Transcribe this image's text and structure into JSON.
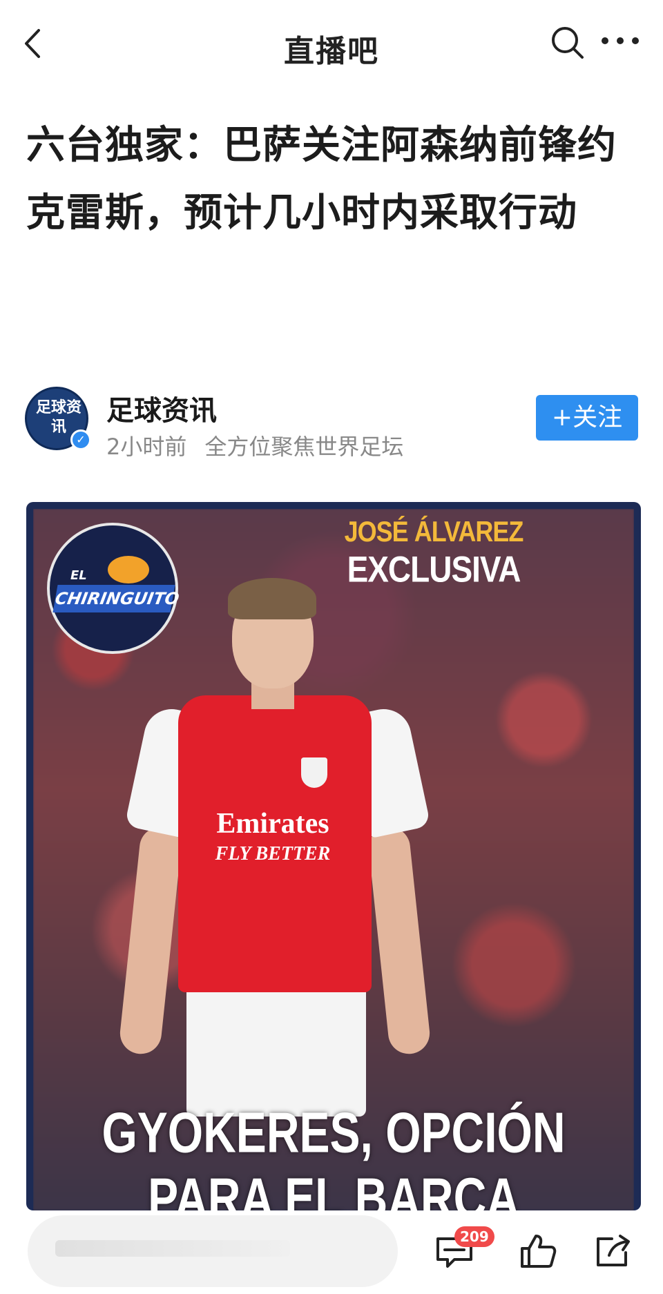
{
  "nav": {
    "title": "直播吧"
  },
  "article": {
    "headline": "六台独家：巴萨关注阿森纳前锋约克雷斯，预计几小时内采取行动"
  },
  "author": {
    "avatar_text": "足球资讯",
    "name": "足球资讯",
    "time": "2小时前",
    "tagline": "全方位聚焦世界足坛",
    "follow_label": "+关注"
  },
  "photo": {
    "logo_el": "EL",
    "logo_name": "CHIRINGUITO",
    "exclusive_name": "JOSÉ ÁLVAREZ",
    "exclusive_word": "EXCLUSIVA",
    "sponsor_line1": "Emirates",
    "sponsor_line2": "FLY BETTER",
    "caption_line1": "GYOKERES, OPCIÓN",
    "caption_line2": "PARA EL BARÇA"
  },
  "bottom": {
    "comment_count": "209"
  },
  "colors": {
    "accent": "#2e8ff0",
    "badge": "#f04a4a",
    "jersey": "#e11f2b"
  },
  "icons": [
    "back-icon",
    "search-icon",
    "more-icon",
    "comment-icon",
    "like-icon",
    "share-icon",
    "verified-icon"
  ]
}
